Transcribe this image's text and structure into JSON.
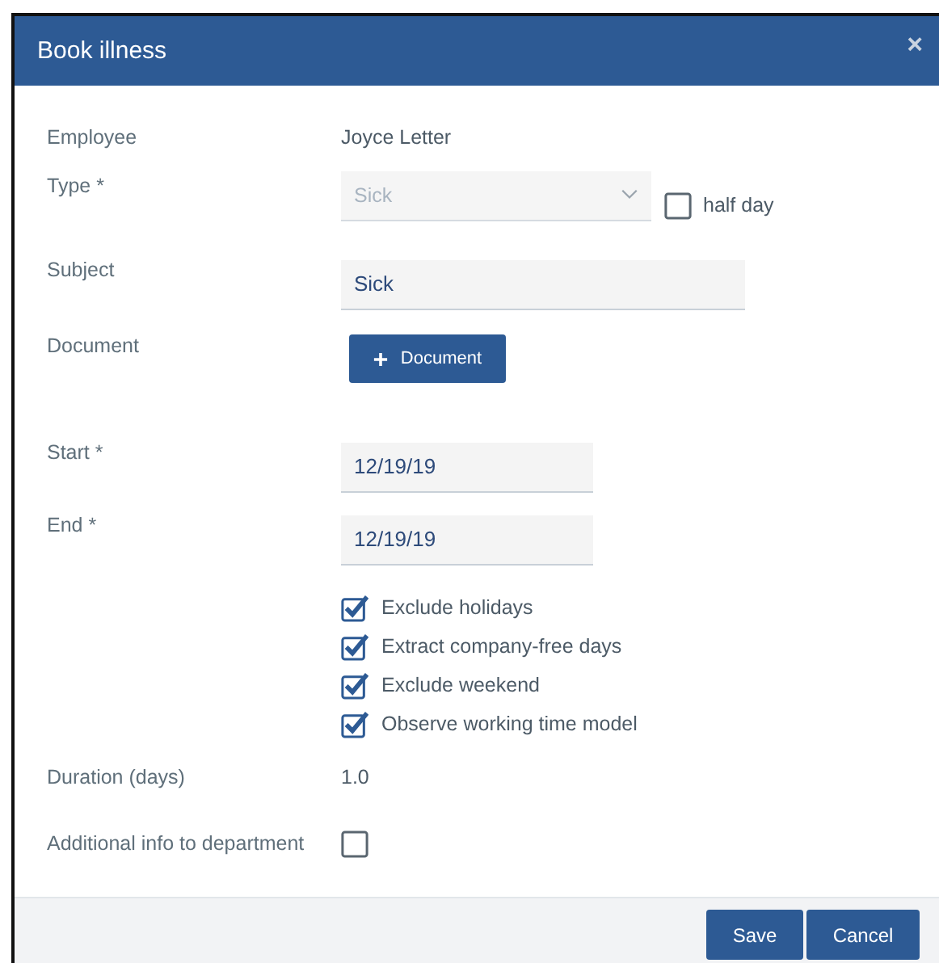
{
  "dialog": {
    "title": "Book illness",
    "close": "×"
  },
  "fields": [
    {
      "kind": "text",
      "label": "Employee",
      "value": "Joyce Letter"
    },
    {
      "kind": "select",
      "label": "Type *",
      "value": "Sick",
      "disabled": true,
      "checkbox": {
        "label": "half day",
        "checked": false
      }
    },
    {
      "kind": "input",
      "label": "Subject",
      "value": "Sick"
    },
    {
      "kind": "button",
      "label": "Document",
      "button": "Document"
    },
    {
      "kind": "date",
      "label": "Start *",
      "value": "12/19/19"
    },
    {
      "kind": "date",
      "label": "End *",
      "value": "12/19/19"
    },
    {
      "kind": "options",
      "options": [
        {
          "label": "Exclude holidays",
          "checked": true
        },
        {
          "label": "Extract company-free days",
          "checked": true
        },
        {
          "label": "Exclude weekend",
          "checked": true
        },
        {
          "label": "Observe working time model",
          "checked": true
        }
      ]
    },
    {
      "kind": "text",
      "label": "Duration (days)",
      "value": "1.0"
    },
    {
      "kind": "checkbox",
      "label": "Additional info to department",
      "checked": false
    }
  ],
  "buttons": [
    "Save",
    "Cancel"
  ]
}
